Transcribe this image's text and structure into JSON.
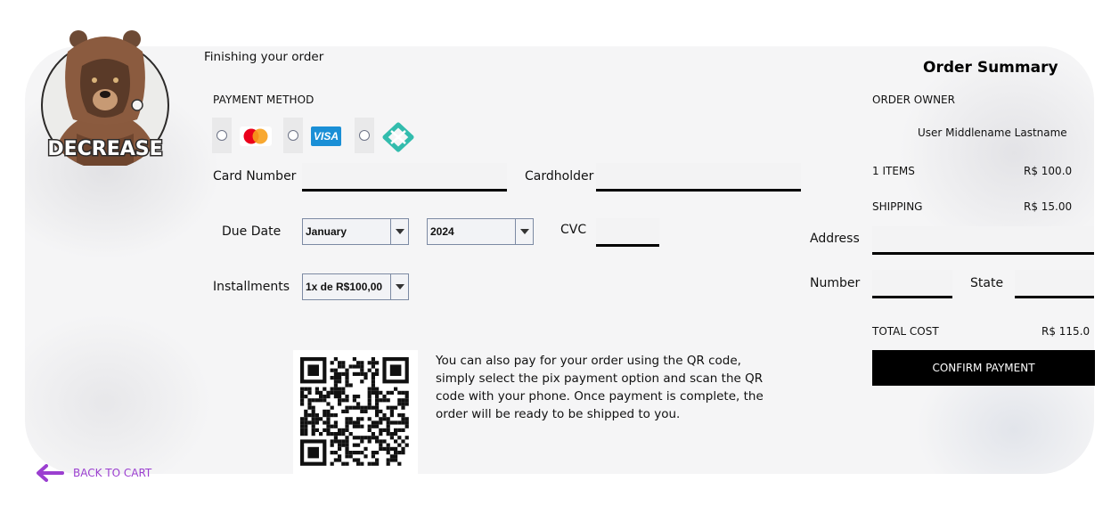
{
  "brand": {
    "logo_text": "DECREASE"
  },
  "checkout": {
    "heading": "Finishing your order",
    "payment_method_label": "PAYMENT METHOD",
    "payment_options": [
      {
        "name": "mastercard",
        "icon": "mastercard-icon"
      },
      {
        "name": "visa",
        "icon": "visa-icon",
        "badge": "VISA"
      },
      {
        "name": "pix",
        "icon": "pix-icon"
      }
    ],
    "card_number_label": "Card Number",
    "card_number_value": "",
    "cardholder_label": "Cardholder",
    "cardholder_value": "",
    "due_date_label": "Due Date",
    "month_selected": "January",
    "year_selected": "2024",
    "cvc_label": "CVC",
    "cvc_value": "",
    "installments_label": "Installments",
    "installments_selected": "1x de R$100,00",
    "qr_text": "You can also pay for your order using the QR code, simply select the pix payment option and scan the QR code with your phone. Once payment is complete, the order will be ready to be shipped to you."
  },
  "summary": {
    "title": "Order Summary",
    "owner_label": "ORDER OWNER",
    "owner_name": "User Middlename Lastname",
    "items_label": "1 ITEMS",
    "items_value": "R$ 100.0",
    "shipping_label": "SHIPPING",
    "shipping_value": "R$ 15.00",
    "address_label": "Address",
    "address_value": "",
    "number_label": "Number",
    "number_value": "",
    "state_label": "State",
    "state_value": "",
    "total_label": "TOTAL COST",
    "total_value": "R$ 115.0",
    "confirm_label": "CONFIRM PAYMENT"
  },
  "nav": {
    "back_label": "BACK TO CART",
    "back_color": "#9b3fd0"
  },
  "colors": {
    "mastercard_red": "#eb001b",
    "mastercard_orange": "#f79e1b",
    "visa_blue": "#1a8fd6",
    "pix_teal": "#32bcad",
    "confirm_bg": "#000000"
  }
}
